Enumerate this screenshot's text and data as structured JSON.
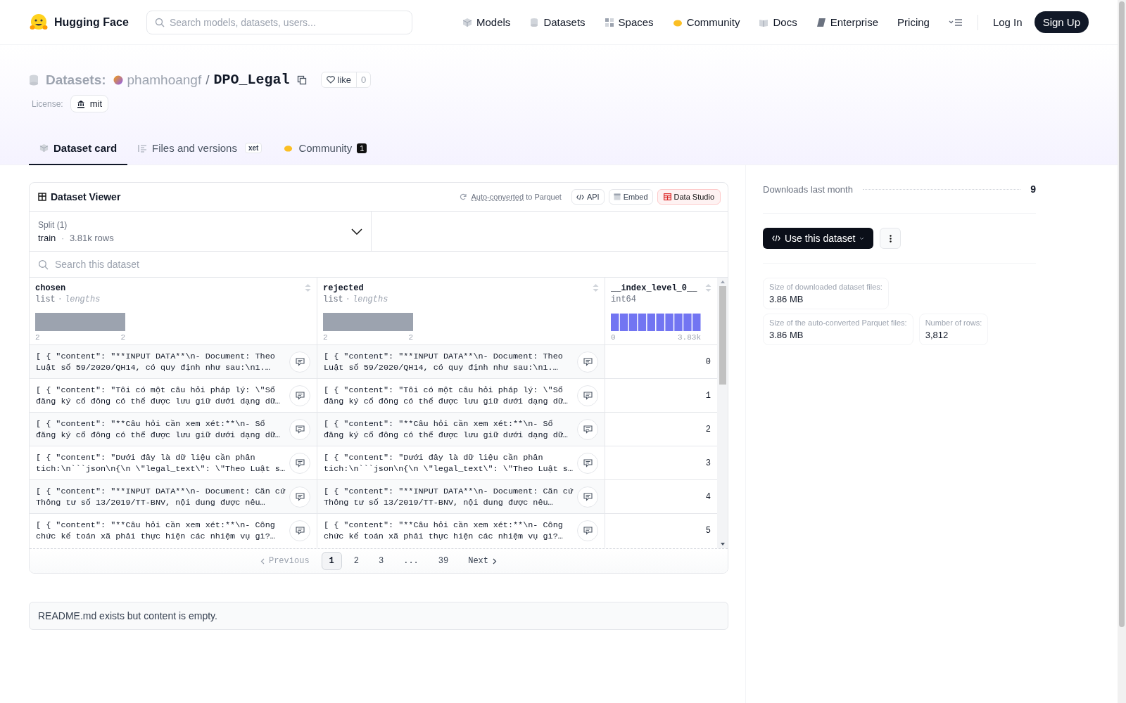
{
  "nav": {
    "brand": "Hugging Face",
    "search": {
      "placeholder": "Search models, datasets, users..."
    },
    "links": [
      {
        "kind": "models",
        "label": "Models"
      },
      {
        "kind": "datasets",
        "label": "Datasets"
      },
      {
        "kind": "spaces",
        "label": "Spaces"
      },
      {
        "kind": "community",
        "label": "Community"
      },
      {
        "kind": "docs",
        "label": "Docs"
      },
      {
        "kind": "enterprise",
        "label": "Enterprise"
      },
      {
        "kind": "plain",
        "label": "Pricing"
      }
    ],
    "login": "Log In",
    "signup": "Sign Up"
  },
  "header": {
    "section": "Datasets:",
    "owner": "phamhoangf",
    "separator": "/",
    "name": "DPO_Legal",
    "like_label": "like",
    "like_count": "0",
    "license_label": "License:",
    "license": "mit"
  },
  "tabs": [
    {
      "kind": "card",
      "label": "Dataset card",
      "selected": true
    },
    {
      "kind": "files",
      "label": "Files and versions",
      "badge": "xet",
      "selected": false
    },
    {
      "kind": "community",
      "label": "Community",
      "count": "1",
      "selected": false
    }
  ],
  "viewer": {
    "title": "Dataset Viewer",
    "converted_link": "Auto-converted",
    "converted_rest": "to Parquet",
    "buttons": [
      {
        "kind": "api",
        "label": "API"
      },
      {
        "kind": "embed",
        "label": "Embed"
      },
      {
        "kind": "studio",
        "label": "Data Studio"
      }
    ],
    "split": {
      "label": "Split (1)",
      "name": "train",
      "separator": "·",
      "rows": "3.81k rows"
    },
    "search": {
      "placeholder": "Search this dataset"
    },
    "columns": [
      {
        "kind": "list",
        "name": "chosen",
        "type": "list",
        "sep": "·",
        "stat": "lengths",
        "min": "2",
        "max": "2"
      },
      {
        "kind": "list",
        "name": "rejected",
        "type": "list",
        "sep": "·",
        "stat": "lengths",
        "min": "2",
        "max": "2"
      },
      {
        "kind": "int",
        "name": "__index_level_0__",
        "type": "int64",
        "min": "0",
        "max": "3.83k"
      }
    ],
    "rows": [
      {
        "chosen": "[ { \"content\": \"**INPUT DATA**\\n- Document: Theo Luật số 59/2020/QH14, có quy định như sau:\\n1.…",
        "rejected": "[ { \"content\": \"**INPUT DATA**\\n- Document: Theo Luật số 59/2020/QH14, có quy định như sau:\\n1.…",
        "index": "0"
      },
      {
        "chosen": "[ { \"content\": \"Tôi có một câu hỏi pháp lý: \\\"Sổ đăng ký cổ đông có thể được lưu giữ dưới dạng dữ…",
        "rejected": "[ { \"content\": \"Tôi có một câu hỏi pháp lý: \\\"Sổ đăng ký cổ đông có thể được lưu giữ dưới dạng dữ…",
        "index": "1"
      },
      {
        "chosen": "[ { \"content\": \"**Câu hỏi cần xem xét:**\\n- Sổ đăng ký cổ đông có thể được lưu giữ dưới dạng dữ…",
        "rejected": "[ { \"content\": \"**Câu hỏi cần xem xét:**\\n- Sổ đăng ký cổ đông có thể được lưu giữ dưới dạng dữ…",
        "index": "2"
      },
      {
        "chosen": "[ { \"content\": \"Dưới đây là dữ liệu cần phân tich:\\n```json\\n{\\n \\\"legal_text\\\": \\\"Theo Luật s…",
        "rejected": "[ { \"content\": \"Dưới đây là dữ liệu cần phân tich:\\n```json\\n{\\n \\\"legal_text\\\": \\\"Theo Luật s…",
        "index": "3"
      },
      {
        "chosen": "[ { \"content\": \"**INPUT DATA**\\n- Document: Căn cứ Thông tư số 13/2019/TT-BNV, nội dung được nêu…",
        "rejected": "[ { \"content\": \"**INPUT DATA**\\n- Document: Căn cứ Thông tư số 13/2019/TT-BNV, nội dung được nêu…",
        "index": "4"
      },
      {
        "chosen": "[ { \"content\": \"**Câu hỏi cần xem xét:**\\n- Công chức kế toán xã phải thực hiện các nhiệm vụ gì?…",
        "rejected": "[ { \"content\": \"**Câu hỏi cần xem xét:**\\n- Công chức kế toán xã phải thực hiện các nhiệm vụ gì?…",
        "index": "5"
      }
    ],
    "pagination": [
      {
        "kind": "prev",
        "label": "Previous",
        "disabled": true
      },
      {
        "kind": "page",
        "label": "1",
        "selected": true
      },
      {
        "kind": "page",
        "label": "2",
        "selected": false
      },
      {
        "kind": "page",
        "label": "3",
        "selected": false
      },
      {
        "kind": "gap",
        "label": "..."
      },
      {
        "kind": "page",
        "label": "39",
        "selected": false
      },
      {
        "kind": "next",
        "label": "Next",
        "disabled": false
      }
    ]
  },
  "readme_note": "README.md exists but content is empty.",
  "sidebar": {
    "downloads_label": "Downloads last month",
    "downloads": "9",
    "use_button": "Use this dataset",
    "stats": [
      {
        "label": "Size of downloaded dataset files:",
        "value": "3.86 MB"
      },
      {
        "label": "Size of the auto-converted Parquet files:",
        "value": "3.86 MB"
      },
      {
        "label": "Number of rows:",
        "value": "3,812"
      }
    ]
  }
}
